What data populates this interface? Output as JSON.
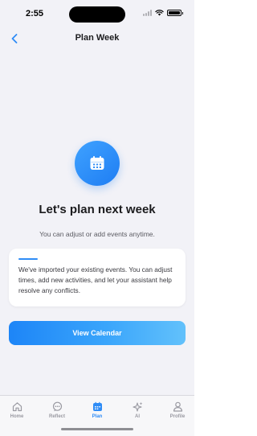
{
  "status_bar": {
    "time": "2:55"
  },
  "header": {
    "title": "Plan Week"
  },
  "hero": {
    "title": "Let's plan next week",
    "subtitle": "You can adjust or add events anytime."
  },
  "info_card": {
    "text": "We've imported your existing events. You can adjust times, add new activities, and let your assistant help resolve any conflicts."
  },
  "cta": {
    "label": "View Calendar"
  },
  "tabs": [
    {
      "label": "Home",
      "icon": "home-icon",
      "active": false
    },
    {
      "label": "Reflect",
      "icon": "chat-bubble-icon",
      "active": false
    },
    {
      "label": "Plan",
      "icon": "calendar-icon",
      "active": true
    },
    {
      "label": "AI",
      "icon": "sparkle-icon",
      "active": false
    },
    {
      "label": "Profile",
      "icon": "person-icon",
      "active": false
    }
  ],
  "colors": {
    "accent": "#2f8cf6",
    "background": "#f2f2f7",
    "inactive_tab": "#9a9aa2"
  }
}
